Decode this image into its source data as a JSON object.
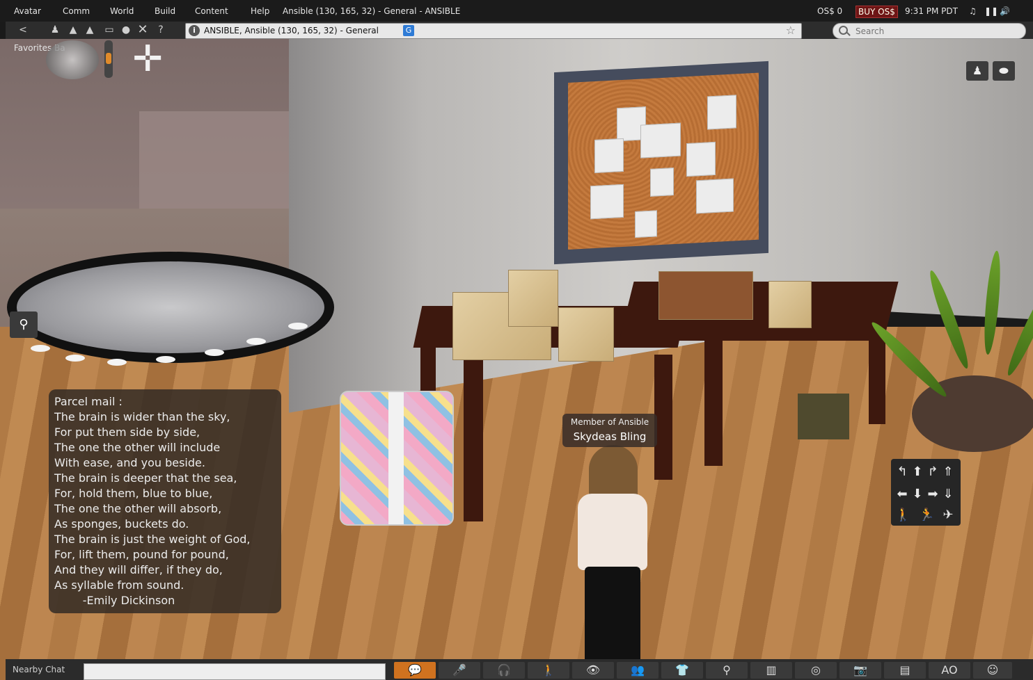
{
  "menubar": {
    "items": [
      "Avatar",
      "Comm",
      "World",
      "Build",
      "Content",
      "Help"
    ],
    "window_title": "Ansible (130, 165, 32) - General - ANSIBLE",
    "balance": "OS$ 0",
    "buy_label": "BUY OS$",
    "time": "9:31 PM PDT"
  },
  "navbar": {
    "location": "ANSIBLE, Ansible (130, 165, 32) - General",
    "search_placeholder": "Search"
  },
  "favorites_label": "Favorites Ba",
  "chat": {
    "lines": [
      "Parcel mail :",
      "The brain is wider than the sky,",
      "For put them side by side,",
      "The one the other will include",
      "With ease, and you beside.",
      "The brain is deeper that the sea,",
      "For, hold them, blue to blue,",
      "The one the other will absorb,",
      "As sponges, buckets do.",
      "The brain is just the weight of God,",
      "For, lift them, pound for pound,",
      "And they will differ, if they do,",
      "As syllable from sound.",
      "        -Emily Dickinson"
    ]
  },
  "nametag": {
    "group": "Member of Ansible",
    "name": "Skydeas Bling"
  },
  "bottombar": {
    "chat_label": "Nearby Chat",
    "ao_label": "AO"
  },
  "icons": {
    "back": "back-arrow-icon",
    "info": "info-icon",
    "star": "star-icon",
    "search": "search-icon",
    "map_pin": "map-pin-icon"
  },
  "colors": {
    "buy_button": "#6e1515",
    "active_toolbar": "#d0721f"
  }
}
